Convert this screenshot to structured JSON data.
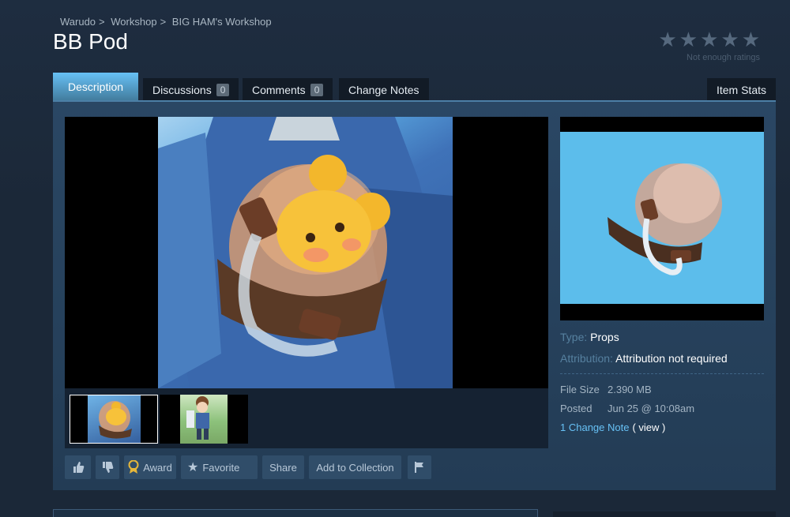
{
  "breadcrumb": [
    "Warudo",
    "Workshop",
    "BIG HAM's Workshop"
  ],
  "breadcrumb_sep": ">",
  "title": "BB Pod",
  "rating": {
    "stars": 5,
    "note": "Not enough ratings",
    "star_color": "#56697e"
  },
  "tabs": [
    {
      "label": "Description",
      "active": true
    },
    {
      "label": "Discussions",
      "count": "0"
    },
    {
      "label": "Comments",
      "count": "0"
    },
    {
      "label": "Change Notes"
    }
  ],
  "item_stats_tab": "Item Stats",
  "actions": {
    "rate_up_icon": "thumbs-up-icon",
    "rate_down_icon": "thumbs-down-icon",
    "award": "Award",
    "favorite": "Favorite",
    "share": "Share",
    "add_to_collection": "Add to Collection",
    "report_icon": "flag-icon"
  },
  "details": {
    "type_label": "Type:",
    "type_value": "Props",
    "attribution_label": "Attribution:",
    "attribution_value": "Attribution not required",
    "file_size_label": "File Size",
    "file_size_value": "2.390 MB",
    "posted_label": "Posted",
    "posted_value": "Jun 25 @ 10:08am",
    "change_note_link": "1 Change Note",
    "view_link": "( view )"
  },
  "colors": {
    "accent": "#67c1f5",
    "background": "#1b2838",
    "panel": "#2a4764"
  }
}
